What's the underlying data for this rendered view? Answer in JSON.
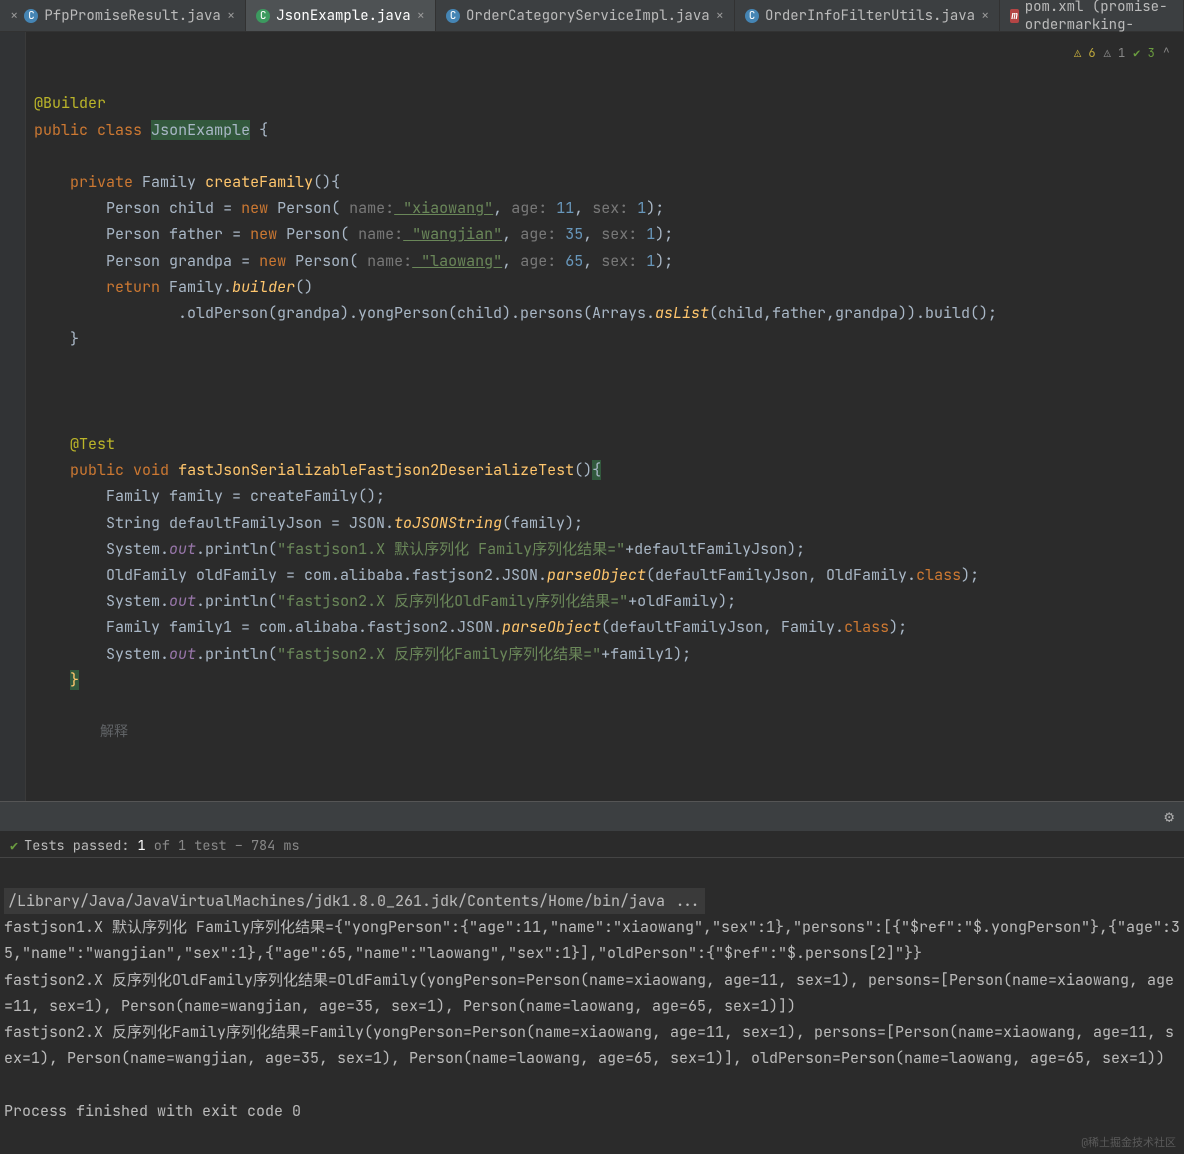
{
  "tabs": [
    {
      "label": "PfpPromiseResult.java",
      "close": "×"
    },
    {
      "label": "JsonExample.java",
      "close": "×"
    },
    {
      "label": "OrderCategoryServiceImpl.java",
      "close": "×"
    },
    {
      "label": "OrderInfoFilterUtils.java",
      "close": "×"
    },
    {
      "label": "pom.xml (promise-ordermarking-",
      "close": ""
    }
  ],
  "icons": {
    "java": "C",
    "pom": "m"
  },
  "status_bar": {
    "warn_y": "⚠ 6",
    "warn_g": "⚠ 1",
    "check": "✔ 3",
    "arrow": "^"
  },
  "code": {
    "l1_ann": "@Builder",
    "l2_kw1": "public",
    "l2_kw2": "class",
    "l2_cls": "JsonExample",
    "l2_brace": "{",
    "l4_kw": "private",
    "l4_type": "Family",
    "l4_name": "createFamily",
    "l4_tail": "(){",
    "l5_type": "Person",
    "l5_var": "child",
    "l5_eq": "=",
    "l5_new": "new",
    "l5_ctor": "Person(",
    "l5_hint1": " name:",
    "l5_v1": " \"xiaowang\"",
    "l5_c1": ",",
    "l5_hint2": " age:",
    "l5_v2": " 11",
    "l5_c2": ",",
    "l5_hint3": " sex:",
    "l5_v3": " 1",
    "l5_end": ");",
    "l6_var": "father",
    "l6_v1": " \"wangjian\"",
    "l6_v2": " 35",
    "l6_v3": " 1",
    "l7_var": "grandpa",
    "l7_v1": " \"laowang\"",
    "l7_v2": " 65",
    "l7_v3": " 1",
    "l8_kw": "return",
    "l8_a": "Family.",
    "l8_b": "builder",
    "l8_c": "()",
    "l9_a": ".oldPerson(grandpa).yongPerson(child).persons(Arrays.",
    "l9_b": "asList",
    "l9_c": "(child,father,grandpa)).build();",
    "l10_brace": "}",
    "l13_ann": "@Test",
    "l14_kw1": "public",
    "l14_kw2": "void",
    "l14_name": "fastJsonSerializableFastjson2DeserializeTest",
    "l14_tail": "()",
    "l14_brace": "{",
    "l15_a": "Family family = createFamily();",
    "l16_a": "String defaultFamilyJson = JSON.",
    "l16_b": "toJSONString",
    "l16_c": "(family);",
    "l17_a": "System.",
    "l17_f": "out",
    "l17_b": ".println(",
    "l17_s": "\"fastjson1.X 默认序列化 Family序列化结果=\"",
    "l17_c": "+defaultFamilyJson);",
    "l18_a": "OldFamily oldFamily = com.alibaba.fastjson2.JSON.",
    "l18_b": "parseObject",
    "l18_c": "(defaultFamilyJson, OldFamily.",
    "l18_kw": "class",
    "l18_d": ");",
    "l19_a": "System.",
    "l19_f": "out",
    "l19_b": ".println(",
    "l19_s": "\"fastjson2.X 反序列化OldFamily序列化结果=\"",
    "l19_c": "+oldFamily);",
    "l20_a": "Family family1 = com.alibaba.fastjson2.JSON.",
    "l20_b": "parseObject",
    "l20_c": "(defaultFamilyJson, Family.",
    "l20_kw": "class",
    "l20_d": ");",
    "l21_a": "System.",
    "l21_f": "out",
    "l21_b": ".println(",
    "l21_s": "\"fastjson2.X 反序列化Family序列化结果=\"",
    "l21_c": "+family1);",
    "l22_brace": "}",
    "inlay": "解释"
  },
  "tests": {
    "tick": "✔",
    "label_a": "Tests passed: ",
    "count": "1",
    "label_b": " of 1 test – 784 ms"
  },
  "console": {
    "cmd": "/Library/Java/JavaVirtualMachines/jdk1.8.0_261.jdk/Contents/Home/bin/java ...",
    "out1": "fastjson1.X 默认序列化 Family序列化结果={\"yongPerson\":{\"age\":11,\"name\":\"xiaowang\",\"sex\":1},\"persons\":[{\"$ref\":\"$.yongPerson\"},{\"age\":35,\"name\":\"wangjian\",\"sex\":1},{\"age\":65,\"name\":\"laowang\",\"sex\":1}],\"oldPerson\":{\"$ref\":\"$.persons[2]\"}}",
    "out2": "fastjson2.X 反序列化OldFamily序列化结果=OldFamily(yongPerson=Person(name=xiaowang, age=11, sex=1), persons=[Person(name=xiaowang, age=11, sex=1), Person(name=wangjian, age=35, sex=1), Person(name=laowang, age=65, sex=1)])",
    "out3": "fastjson2.X 反序列化Family序列化结果=Family(yongPerson=Person(name=xiaowang, age=11, sex=1), persons=[Person(name=xiaowang, age=11, sex=1), Person(name=wangjian, age=35, sex=1), Person(name=laowang, age=65, sex=1)], oldPerson=Person(name=laowang, age=65, sex=1))",
    "exit": "Process finished with exit code 0"
  },
  "watermark": "@稀土掘金技术社区"
}
